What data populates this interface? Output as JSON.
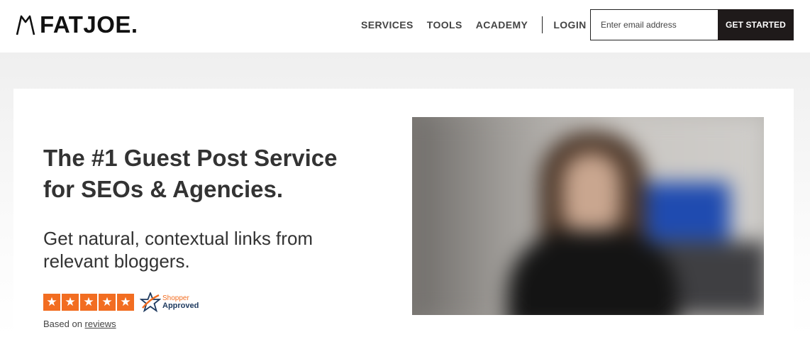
{
  "header": {
    "logo_text": "FATJOE.",
    "nav": [
      {
        "label": "SERVICES"
      },
      {
        "label": "TOOLS"
      },
      {
        "label": "ACADEMY"
      }
    ],
    "login_label": "LOGIN",
    "email_placeholder": "Enter email address",
    "cta_label": "GET STARTED"
  },
  "hero": {
    "headline_line1": "The #1 Guest Post Service",
    "headline_line2": "for SEOs & Agencies.",
    "subhead_line1": "Get natural, contextual links from",
    "subhead_line2": "relevant bloggers.",
    "rating": {
      "stars": 5,
      "badge_top": "Shopper",
      "badge_bottom": "Approved",
      "based_on_prefix": "Based on ",
      "based_on_link": "reviews"
    }
  },
  "colors": {
    "accent_orange": "#f26d21",
    "dark_button": "#1f1a1a"
  }
}
